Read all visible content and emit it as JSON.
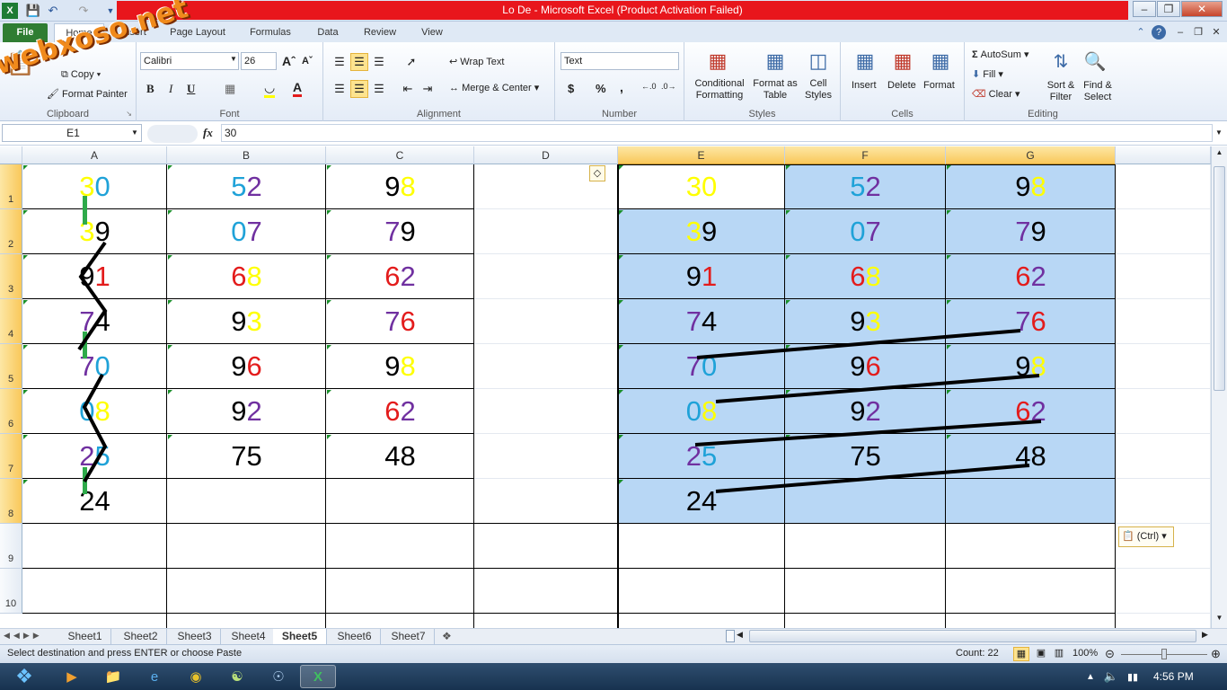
{
  "window": {
    "title": "Lo De  -  Microsoft Excel (Product Activation Failed)",
    "watermark": "webxoso.net"
  },
  "quick_access": [
    "save-icon",
    "undo-icon",
    "redo-icon",
    "customize-icon"
  ],
  "ribbon_tabs": [
    "File",
    "Home",
    "Insert",
    "Page Layout",
    "Formulas",
    "Data",
    "Review",
    "View"
  ],
  "ribbon": {
    "clipboard": {
      "name": "Clipboard",
      "paste": "Paste",
      "copy": "Copy",
      "format_painter": "Format Painter"
    },
    "font": {
      "name": "Font",
      "family": "Calibri",
      "size": "26",
      "bold": "B",
      "italic": "I",
      "underline": "U"
    },
    "alignment": {
      "name": "Alignment",
      "wrap_text": "Wrap Text",
      "merge_center": "Merge & Center"
    },
    "number": {
      "name": "Number",
      "format": "Text",
      "currency": "$",
      "percent": "%",
      "comma": ","
    },
    "styles": {
      "name": "Styles",
      "conditional": "Conditional Formatting",
      "format_table": "Format as Table",
      "cell_styles": "Cell Styles"
    },
    "cells": {
      "name": "Cells",
      "insert": "Insert",
      "delete": "Delete",
      "format": "Format"
    },
    "editing": {
      "name": "Editing",
      "autosum": "AutoSum",
      "fill": "Fill",
      "clear": "Clear",
      "sort_filter": "Sort & Filter",
      "find_select": "Find & Select"
    }
  },
  "formula_bar": {
    "name_box": "E1",
    "fx": "fx",
    "value": "30"
  },
  "columns": [
    "A",
    "B",
    "C",
    "D",
    "E",
    "F",
    "G"
  ],
  "rows": [
    "1",
    "2",
    "3",
    "4",
    "5",
    "6",
    "7",
    "8",
    "9",
    "10"
  ],
  "colors": {
    "yellow": "#ffff00",
    "blue": "#1fa2d8",
    "purple": "#7030a0",
    "red": "#e31c1c",
    "black": "#000000",
    "selection": "#b8d7f5",
    "header_highlight": "#f9c85a"
  },
  "cells": {
    "A": [
      [
        "3",
        "yellow",
        "0",
        "blue"
      ],
      [
        "3",
        "yellow",
        "9",
        "black"
      ],
      [
        "9",
        "black",
        "1",
        "red"
      ],
      [
        "7",
        "purple",
        "4",
        "black"
      ],
      [
        "7",
        "purple",
        "0",
        "blue"
      ],
      [
        "0",
        "blue",
        "8",
        "yellow"
      ],
      [
        "2",
        "purple",
        "5",
        "blue"
      ],
      [
        "2",
        "black",
        "4",
        "black"
      ]
    ],
    "B": [
      [
        "5",
        "blue",
        "2",
        "purple"
      ],
      [
        "0",
        "blue",
        "7",
        "purple"
      ],
      [
        "6",
        "red",
        "8",
        "yellow"
      ],
      [
        "9",
        "black",
        "3",
        "yellow"
      ],
      [
        "9",
        "black",
        "6",
        "red"
      ],
      [
        "9",
        "black",
        "2",
        "purple"
      ],
      [
        "7",
        "black",
        "5",
        "black"
      ]
    ],
    "C": [
      [
        "9",
        "black",
        "8",
        "yellow"
      ],
      [
        "7",
        "purple",
        "9",
        "black"
      ],
      [
        "6",
        "red",
        "2",
        "purple"
      ],
      [
        "7",
        "purple",
        "6",
        "red"
      ],
      [
        "9",
        "black",
        "8",
        "yellow"
      ],
      [
        "6",
        "red",
        "2",
        "purple"
      ],
      [
        "4",
        "black",
        "8",
        "black"
      ]
    ],
    "E": [
      [
        "3",
        "yellow",
        "0",
        "yellow"
      ],
      [
        "3",
        "yellow",
        "9",
        "black"
      ],
      [
        "9",
        "black",
        "1",
        "red"
      ],
      [
        "7",
        "purple",
        "4",
        "black"
      ],
      [
        "7",
        "purple",
        "0",
        "blue"
      ],
      [
        "0",
        "blue",
        "8",
        "yellow"
      ],
      [
        "2",
        "purple",
        "5",
        "blue"
      ],
      [
        "2",
        "black",
        "4",
        "black"
      ]
    ],
    "F": [
      [
        "5",
        "blue",
        "2",
        "purple"
      ],
      [
        "0",
        "blue",
        "7",
        "purple"
      ],
      [
        "6",
        "red",
        "8",
        "yellow"
      ],
      [
        "9",
        "black",
        "3",
        "yellow"
      ],
      [
        "9",
        "black",
        "6",
        "red"
      ],
      [
        "9",
        "black",
        "2",
        "purple"
      ],
      [
        "7",
        "black",
        "5",
        "black"
      ]
    ],
    "G": [
      [
        "9",
        "black",
        "8",
        "yellow"
      ],
      [
        "7",
        "purple",
        "9",
        "black"
      ],
      [
        "6",
        "red",
        "2",
        "purple"
      ],
      [
        "7",
        "purple",
        "6",
        "red"
      ],
      [
        "9",
        "black",
        "8",
        "yellow"
      ],
      [
        "6",
        "red",
        "2",
        "purple"
      ],
      [
        "4",
        "black",
        "8",
        "black"
      ]
    ]
  },
  "paste_options": "(Ctrl)",
  "sheets": [
    "Sheet1",
    "Sheet2",
    "Sheet3",
    "Sheet4",
    "Sheet5",
    "Sheet6",
    "Sheet7"
  ],
  "active_sheet": "Sheet5",
  "status": {
    "message": "Select destination and press ENTER or choose Paste",
    "count": "Count: 22",
    "zoom": "100%"
  },
  "taskbar": {
    "time": "4:56 PM"
  }
}
